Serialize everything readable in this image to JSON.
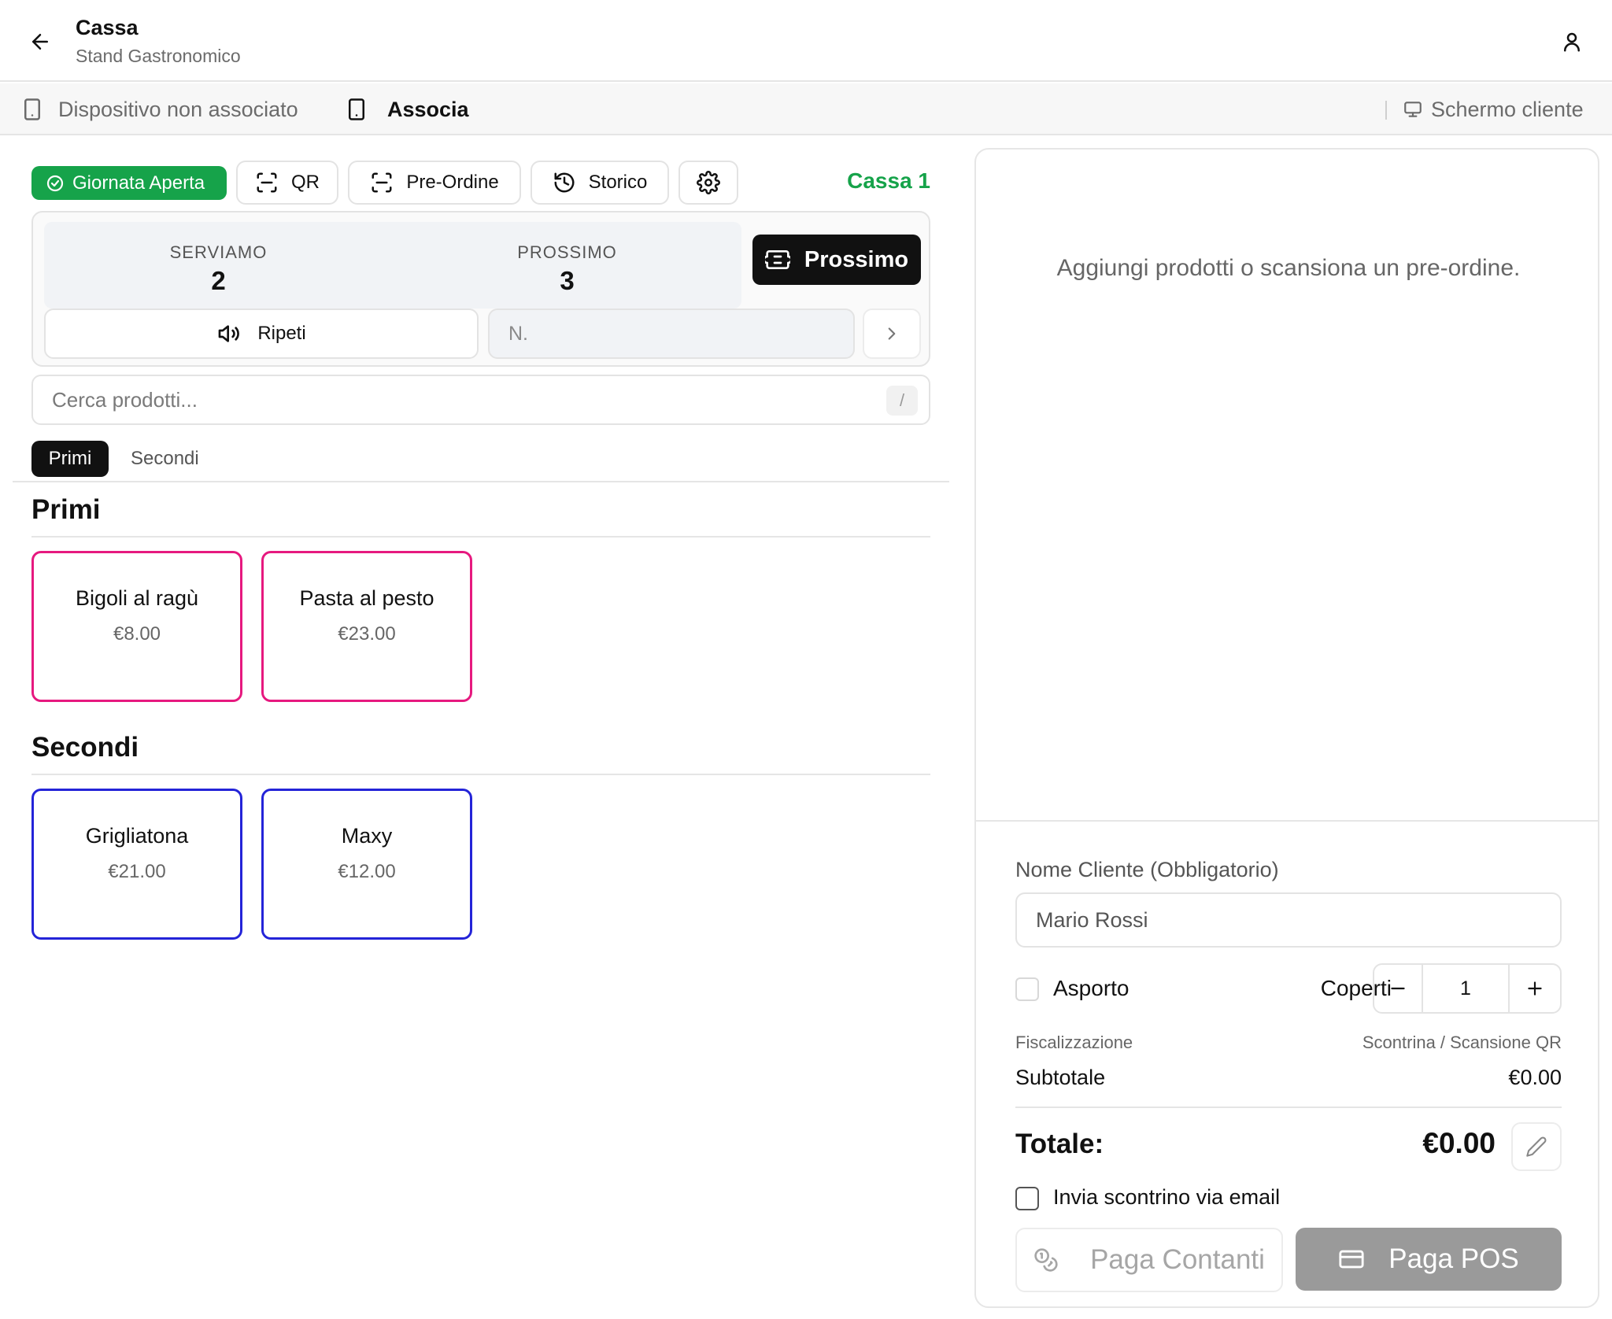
{
  "header": {
    "title": "Cassa",
    "subtitle": "Stand Gastronomico"
  },
  "device_bar": {
    "status": "Dispositivo non associato",
    "associate_label": "Associa",
    "customer_screen_label": "Schermo cliente"
  },
  "toolbar": {
    "day_status": "Giornata Aperta",
    "qr_label": "QR",
    "preorder_label": "Pre-Ordine",
    "history_label": "Storico",
    "register_name": "Cassa 1"
  },
  "queue": {
    "serving_label": "SERVIAMO",
    "serving_number": "2",
    "next_label": "PROSSIMO",
    "next_number": "3",
    "next_button": "Prossimo",
    "repeat_button": "Ripeti",
    "number_placeholder": "N."
  },
  "search": {
    "placeholder": "Cerca prodotti...",
    "shortcut": "/"
  },
  "tabs": [
    {
      "label": "Primi",
      "active": true
    },
    {
      "label": "Secondi",
      "active": false
    }
  ],
  "sections": [
    {
      "title": "Primi",
      "color": "#e6197f",
      "products": [
        {
          "name": "Bigoli al ragù",
          "price": "€8.00"
        },
        {
          "name": "Pasta al pesto",
          "price": "€23.00"
        }
      ]
    },
    {
      "title": "Secondi",
      "color": "#2424d8",
      "products": [
        {
          "name": "Grigliatona",
          "price": "€21.00"
        },
        {
          "name": "Maxy",
          "price": "€12.00"
        }
      ]
    }
  ],
  "cart": {
    "empty_message": "Aggiungi prodotti o scansiona un pre-ordine.",
    "customer_name_label": "Nome Cliente (Obbligatorio)",
    "customer_name_placeholder": "Mario Rossi",
    "takeaway_label": "Asporto",
    "takeaway_checked": false,
    "covers_label": "Coperti",
    "covers_value": "1",
    "fiscal_label": "Fiscalizzazione",
    "fiscal_value": "Scontrina / Scansione QR",
    "subtotal_label": "Subtotale",
    "subtotal_value": "€0.00",
    "total_label": "Totale:",
    "total_value": "€0.00",
    "email_receipt_label": "Invia scontrino via email",
    "email_receipt_checked": false,
    "pay_cash_label": "Paga Contanti",
    "pay_pos_label": "Paga POS"
  },
  "colors": {
    "accent_green": "#16a34a",
    "primi_border": "#e6197f",
    "secondi_border": "#2424d8",
    "dark": "#111111"
  }
}
